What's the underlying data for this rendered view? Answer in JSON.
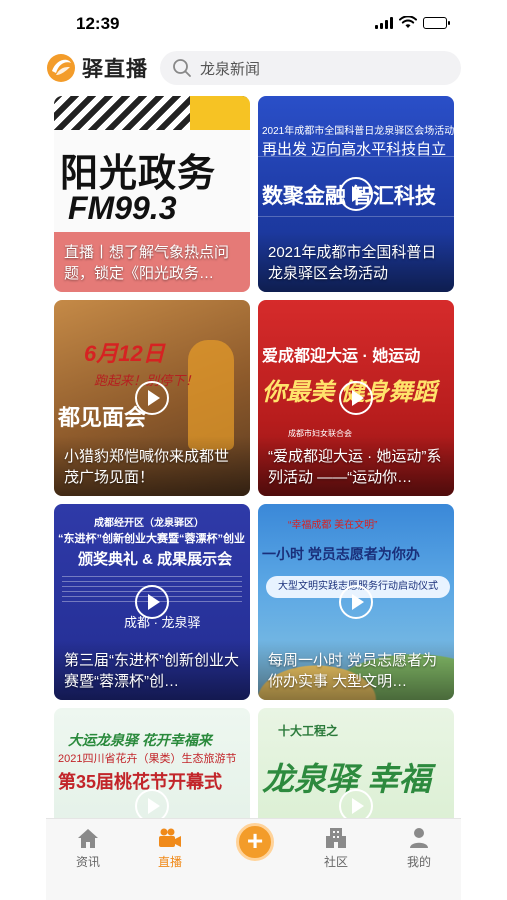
{
  "status_bar": {
    "time": "12:39"
  },
  "header": {
    "app_name": "驿直播",
    "search_placeholder": "龙泉新闻"
  },
  "feed": [
    {
      "id": "card1",
      "title": "直播丨想了解气象热点问题，锁定《阳光政务…",
      "art": {
        "big1": "阳光政务",
        "big2": "FM99.3"
      }
    },
    {
      "id": "card2",
      "title": "2021年成都市全国科普日龙泉驿区会场活动",
      "art": {
        "l1": "2021年成都市全国科普日龙泉驿区会场活动",
        "l2": "再出发 迈向高水平科技自立",
        "l3": "数聚金融 智汇科技"
      }
    },
    {
      "id": "card3",
      "title": "小猎豹郑恺喊你来成都世茂广场见面！",
      "art": {
        "l1": "6月12日",
        "l2": "跑起来！别停下！",
        "l3": "都见面会"
      }
    },
    {
      "id": "card4",
      "title": "“爱成都迎大运 · 她运动”系列活动 ——“运动你…",
      "art": {
        "l1": "爱成都迎大运 · 她运动",
        "l2": "你最美 健身舞蹈",
        "l3": "成都市妇女联合会"
      }
    },
    {
      "id": "card5",
      "title": "第三届“东进杯”创新创业大赛暨“蓉漂杯”创…",
      "art": {
        "l1": "成都经开区（龙泉驿区）",
        "l2": "“东进杯”创新创业大赛暨“蓉漂杯”创业",
        "l3": "颁奖典礼 & 成果展示会",
        "l4": "成都 · 龙泉驿"
      }
    },
    {
      "id": "card6",
      "title": "每周一小时 党员志愿者为你办实事 大型文明…",
      "art": {
        "l1": "“幸福成都 美在文明”",
        "l2": "一小时 党员志愿者为你办",
        "l3": "大型文明实践志愿服务行动启动仪式"
      }
    },
    {
      "id": "card7",
      "title": "",
      "art": {
        "l1": "大运龙泉驿 花开幸福来",
        "l2": "2021四川省花卉（果类）生态旅游节",
        "l3": "第35届桃花节开幕式"
      }
    },
    {
      "id": "card8",
      "title": "",
      "art": {
        "l1": "十大工程之",
        "l2": "龙泉驿 幸福"
      }
    }
  ],
  "tabbar": {
    "tabs": [
      {
        "label": "资讯",
        "icon": "home-icon",
        "active": false
      },
      {
        "label": "直播",
        "icon": "video-camera-icon",
        "active": true
      },
      {
        "label": "社区",
        "icon": "building-icon",
        "active": false
      },
      {
        "label": "我的",
        "icon": "person-icon",
        "active": false
      }
    ],
    "fab_icon": "plus-icon"
  },
  "colors": {
    "accent": "#f08a1a",
    "fab": "#f39c2a"
  }
}
